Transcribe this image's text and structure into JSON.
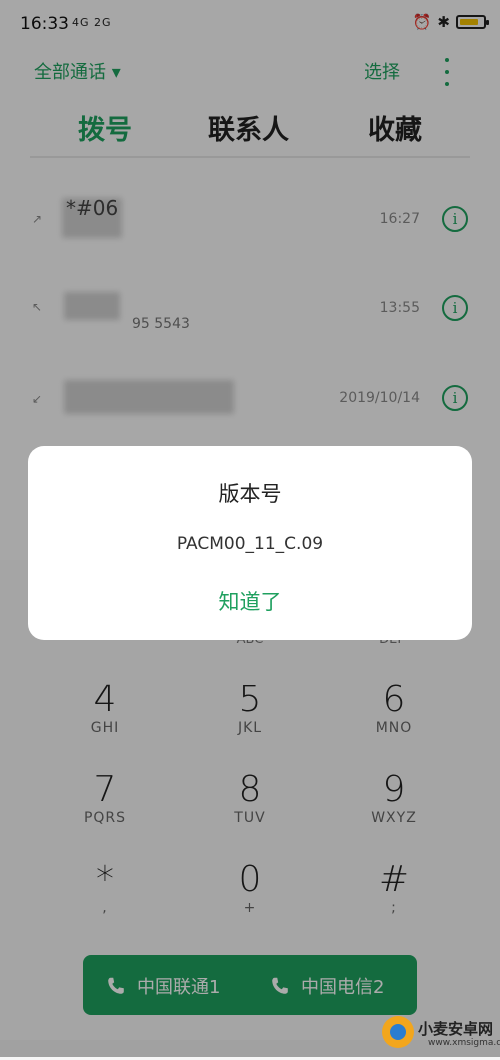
{
  "status_bar": {
    "time": "16:33",
    "signal_text": "4G 2G",
    "alarm_icon": "alarm-icon",
    "bluetooth_icon": "bluetooth-icon",
    "battery_level": 0.8,
    "battery_color": "#f3c000"
  },
  "top_bar": {
    "filter_label": "全部通话 ▾",
    "select_label": "选择"
  },
  "tabs": [
    {
      "label": "拨号",
      "active": true
    },
    {
      "label": "联系人",
      "active": false
    },
    {
      "label": "收藏",
      "active": false
    }
  ],
  "call_log": [
    {
      "name": "*#06",
      "number": "",
      "time": "16:27"
    },
    {
      "name": "",
      "number": "95 5543",
      "time": "13:55"
    },
    {
      "name": "",
      "number": "",
      "time": "2019/10/14"
    }
  ],
  "keypad": {
    "partial_row": [
      "ABC",
      "DEF"
    ],
    "keys": [
      {
        "digit": "4",
        "letters": "GHI"
      },
      {
        "digit": "5",
        "letters": "JKL"
      },
      {
        "digit": "6",
        "letters": "MNO"
      },
      {
        "digit": "7",
        "letters": "PQRS"
      },
      {
        "digit": "8",
        "letters": "TUV"
      },
      {
        "digit": "9",
        "letters": "WXYZ"
      },
      {
        "digit": "*",
        "letters": ","
      },
      {
        "digit": "0",
        "letters": "+"
      },
      {
        "digit": "#",
        "letters": ";"
      }
    ]
  },
  "call_buttons": {
    "sim1": "中国联通1",
    "sim2": "中国电信2"
  },
  "dialog": {
    "title": "版本号",
    "message": "PACM00_11_C.09",
    "ok_label": "知道了"
  },
  "watermark": {
    "name": "小麦安卓网",
    "url": "www.xmsigma.com"
  },
  "colors": {
    "accent": "#1fa05f"
  }
}
